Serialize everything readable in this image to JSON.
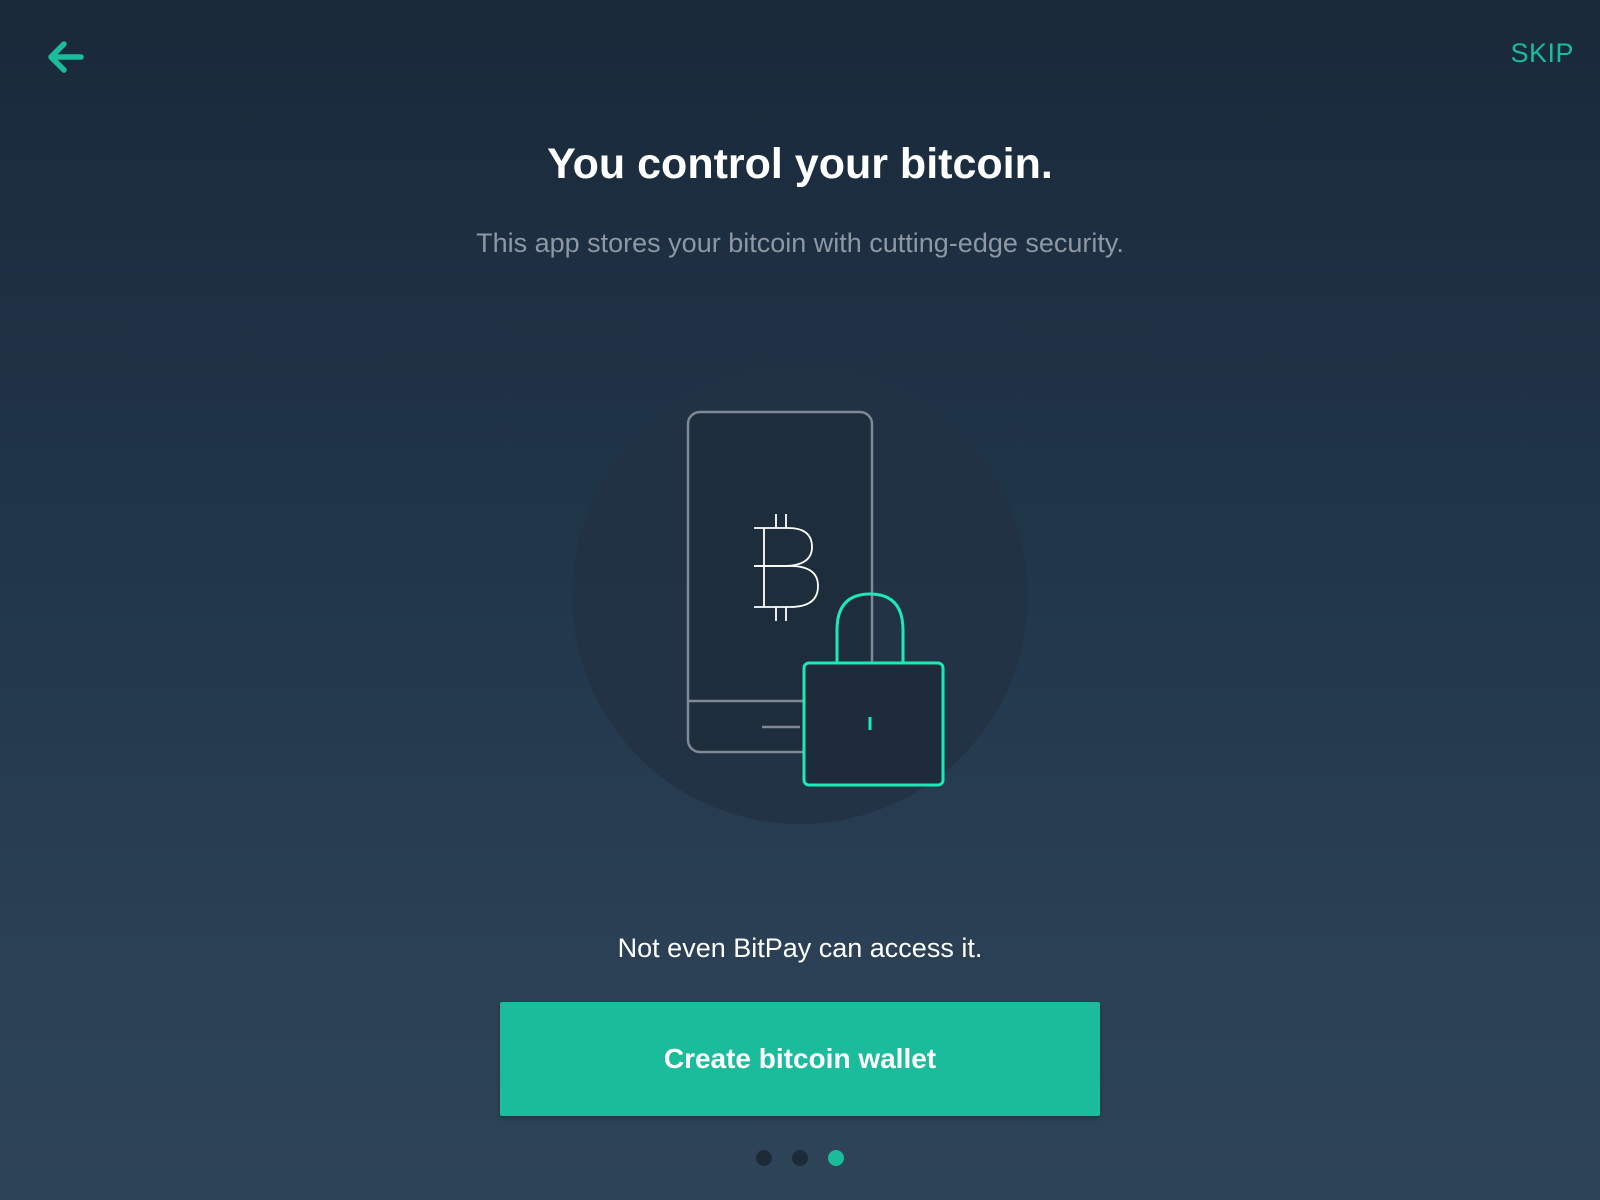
{
  "header": {
    "back_icon": "arrow-left-icon",
    "skip_label": "SKIP"
  },
  "main": {
    "title": "You control your bitcoin.",
    "subtitle": "This app stores your bitcoin with cutting-edge security.",
    "illustration": {
      "icons": [
        "phone-icon",
        "bitcoin-icon",
        "padlock-icon"
      ]
    },
    "footnote": "Not even BitPay can access it.",
    "primary_button_label": "Create bitcoin wallet"
  },
  "pager": {
    "total": 3,
    "active_index": 2
  },
  "colors": {
    "accent": "#1abc9c",
    "background_top": "#19293a",
    "background_bottom": "#2e4458",
    "title_text": "#ffffff",
    "subtitle_text": "#8d98a4"
  }
}
